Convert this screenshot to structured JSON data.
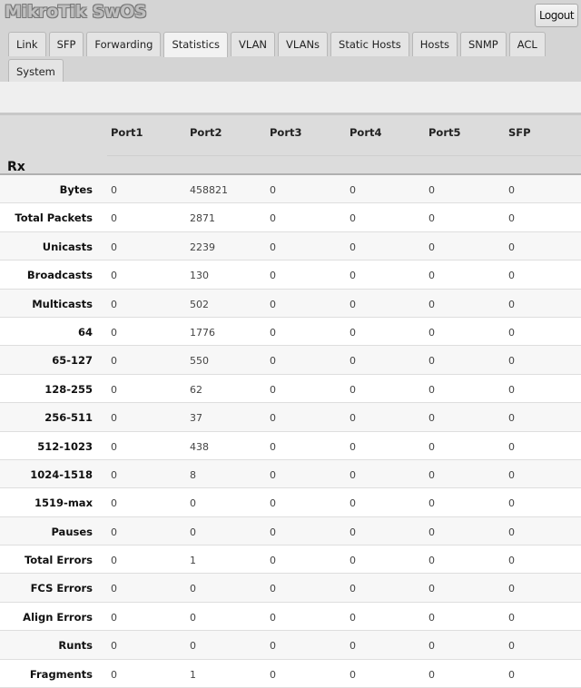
{
  "app": {
    "title": "MikroTik SwOS",
    "logout_label": "Logout"
  },
  "tabs": {
    "row1": [
      "Link",
      "SFP",
      "Forwarding",
      "Statistics",
      "VLAN",
      "VLANs",
      "Static Hosts",
      "Hosts",
      "SNMP",
      "ACL"
    ],
    "row2": [
      "System"
    ],
    "active": "Statistics"
  },
  "table": {
    "section": "Rx",
    "columns": [
      "Port1",
      "Port2",
      "Port3",
      "Port4",
      "Port5",
      "SFP"
    ],
    "rows": [
      {
        "label": "Bytes",
        "values": [
          "0",
          "458821",
          "0",
          "0",
          "0",
          "0"
        ]
      },
      {
        "label": "Total Packets",
        "values": [
          "0",
          "2871",
          "0",
          "0",
          "0",
          "0"
        ]
      },
      {
        "label": "Unicasts",
        "values": [
          "0",
          "2239",
          "0",
          "0",
          "0",
          "0"
        ]
      },
      {
        "label": "Broadcasts",
        "values": [
          "0",
          "130",
          "0",
          "0",
          "0",
          "0"
        ]
      },
      {
        "label": "Multicasts",
        "values": [
          "0",
          "502",
          "0",
          "0",
          "0",
          "0"
        ]
      },
      {
        "label": "64",
        "values": [
          "0",
          "1776",
          "0",
          "0",
          "0",
          "0"
        ]
      },
      {
        "label": "65-127",
        "values": [
          "0",
          "550",
          "0",
          "0",
          "0",
          "0"
        ]
      },
      {
        "label": "128-255",
        "values": [
          "0",
          "62",
          "0",
          "0",
          "0",
          "0"
        ]
      },
      {
        "label": "256-511",
        "values": [
          "0",
          "37",
          "0",
          "0",
          "0",
          "0"
        ]
      },
      {
        "label": "512-1023",
        "values": [
          "0",
          "438",
          "0",
          "0",
          "0",
          "0"
        ]
      },
      {
        "label": "1024-1518",
        "values": [
          "0",
          "8",
          "0",
          "0",
          "0",
          "0"
        ]
      },
      {
        "label": "1519-max",
        "values": [
          "0",
          "0",
          "0",
          "0",
          "0",
          "0"
        ]
      },
      {
        "label": "Pauses",
        "values": [
          "0",
          "0",
          "0",
          "0",
          "0",
          "0"
        ]
      },
      {
        "label": "Total Errors",
        "values": [
          "0",
          "1",
          "0",
          "0",
          "0",
          "0"
        ]
      },
      {
        "label": "FCS Errors",
        "values": [
          "0",
          "0",
          "0",
          "0",
          "0",
          "0"
        ]
      },
      {
        "label": "Align Errors",
        "values": [
          "0",
          "0",
          "0",
          "0",
          "0",
          "0"
        ]
      },
      {
        "label": "Runts",
        "values": [
          "0",
          "0",
          "0",
          "0",
          "0",
          "0"
        ]
      },
      {
        "label": "Fragments",
        "values": [
          "0",
          "1",
          "0",
          "0",
          "0",
          "0"
        ]
      }
    ]
  }
}
